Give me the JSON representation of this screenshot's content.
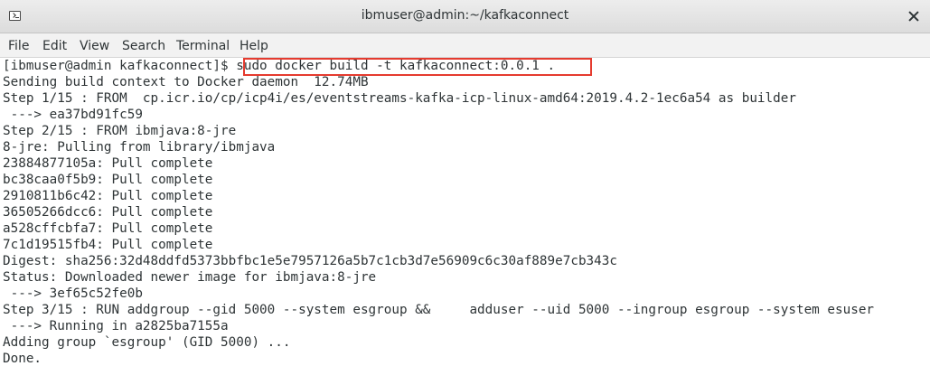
{
  "window": {
    "title": "ibmuser@admin:~/kafkaconnect",
    "icon": "terminal-icon"
  },
  "menu": [
    "File",
    "Edit",
    "View",
    "Search",
    "Terminal",
    "Help"
  ],
  "terminal": {
    "lines": [
      "[ibmuser@admin kafkaconnect]$ sudo docker build -t kafkaconnect:0.0.1 .",
      "Sending build context to Docker daemon  12.74MB",
      "Step 1/15 : FROM  cp.icr.io/cp/icp4i/es/eventstreams-kafka-icp-linux-amd64:2019.4.2-1ec6a54 as builder",
      " ---> ea37bd91fc59",
      "Step 2/15 : FROM ibmjava:8-jre",
      "8-jre: Pulling from library/ibmjava",
      "23884877105a: Pull complete",
      "bc38caa0f5b9: Pull complete",
      "2910811b6c42: Pull complete",
      "36505266dcc6: Pull complete",
      "a528cffcbfa7: Pull complete",
      "7c1d19515fb4: Pull complete",
      "Digest: sha256:32d48ddfd5373bbfbc1e5e7957126a5b7c1cb3d7e56909c6c30af889e7cb343c",
      "Status: Downloaded newer image for ibmjava:8-jre",
      " ---> 3ef65c52fe0b",
      "Step 3/15 : RUN addgroup --gid 5000 --system esgroup &&     adduser --uid 5000 --ingroup esgroup --system esuser",
      " ---> Running in a2825ba7155a",
      "Adding group `esgroup' (GID 5000) ...",
      "Done."
    ]
  },
  "colors": {
    "highlight": "#e53b2f",
    "text": "#2e3436",
    "background": "#ffffff"
  }
}
